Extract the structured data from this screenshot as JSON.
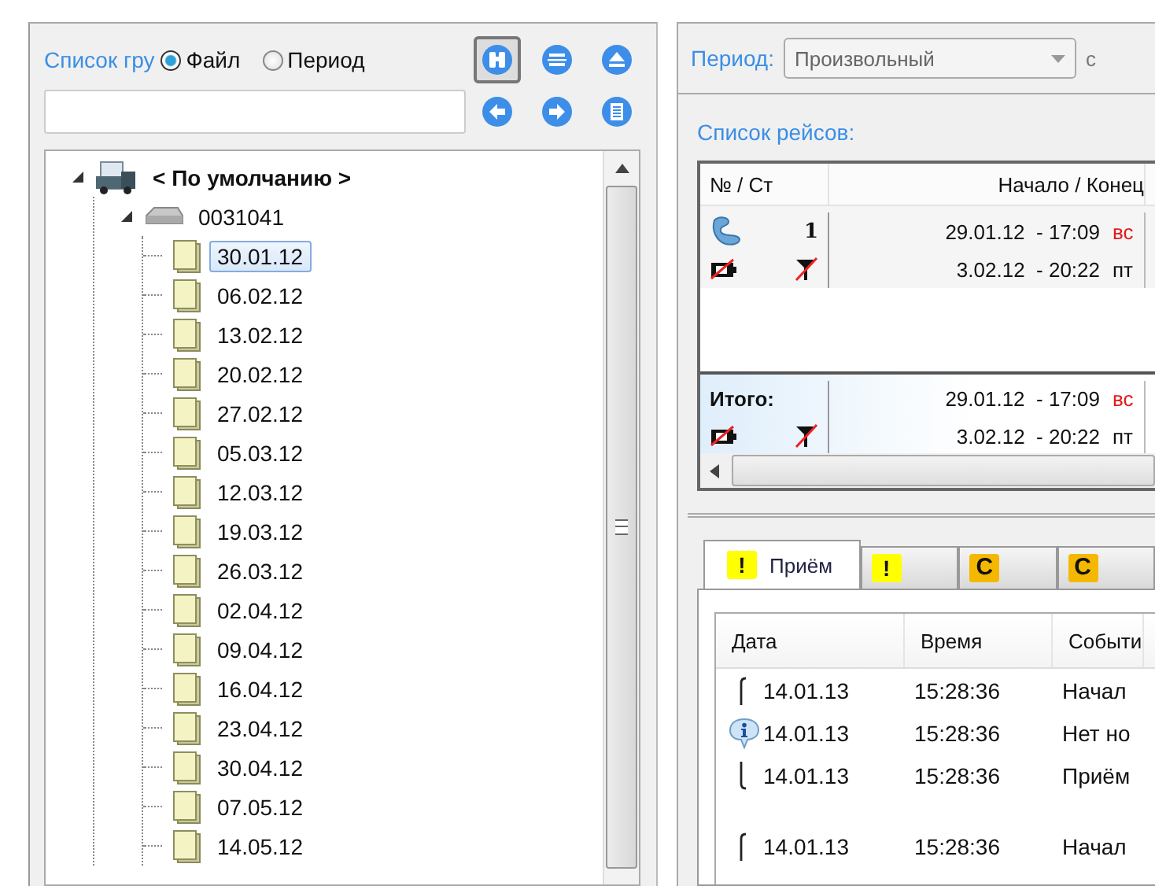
{
  "groups": {
    "title": "Список гру",
    "modes": [
      {
        "label": "Файл",
        "selected": true
      },
      {
        "label": "Период",
        "selected": false
      }
    ],
    "tool_buttons": [
      {
        "selected": true
      },
      {
        "selected": false
      },
      {
        "selected": false
      },
      {
        "selected": false
      },
      {
        "selected": false
      },
      {
        "selected": false
      }
    ]
  },
  "tree": [
    {
      "label": "< По умолчанию >",
      "kind": "root",
      "expanded": true,
      "selected": false,
      "children": [
        {
          "label": "0031041",
          "kind": "device",
          "expanded": true,
          "selected": false,
          "children": [
            {
              "label": "30.01.12",
              "kind": "file",
              "selected": true
            },
            {
              "label": "06.02.12",
              "kind": "file",
              "selected": false
            },
            {
              "label": "13.02.12",
              "kind": "file",
              "selected": false
            },
            {
              "label": "20.02.12",
              "kind": "file",
              "selected": false
            },
            {
              "label": "27.02.12",
              "kind": "file",
              "selected": false
            },
            {
              "label": "05.03.12",
              "kind": "file",
              "selected": false
            },
            {
              "label": "12.03.12",
              "kind": "file",
              "selected": false
            },
            {
              "label": "19.03.12",
              "kind": "file",
              "selected": false
            },
            {
              "label": "26.03.12",
              "kind": "file",
              "selected": false
            },
            {
              "label": "02.04.12",
              "kind": "file",
              "selected": false
            },
            {
              "label": "09.04.12",
              "kind": "file",
              "selected": false
            },
            {
              "label": "16.04.12",
              "kind": "file",
              "selected": false
            },
            {
              "label": "23.04.12",
              "kind": "file",
              "selected": false
            },
            {
              "label": "30.04.12",
              "kind": "file",
              "selected": false
            },
            {
              "label": "07.05.12",
              "kind": "file",
              "selected": false
            },
            {
              "label": "14.05.12",
              "kind": "file",
              "selected": false
            }
          ]
        }
      ]
    }
  ],
  "period": {
    "label": "Период:",
    "value": "Произвольный",
    "disabled": true,
    "trailing": "с"
  },
  "trips": {
    "title": "Список рейсов:",
    "columns": [
      "№ / Ст",
      "Начало / Конец"
    ],
    "rows": [
      {
        "kind": "trip",
        "number": "1",
        "start": "29.01.12  - 17:09",
        "start_day": "вс",
        "start_holiday": true,
        "end": "3.02.12  - 20:22",
        "end_day": "пт",
        "end_holiday": false
      },
      {
        "kind": "total",
        "number": "Итого:",
        "start": "29.01.12  - 17:09",
        "start_day": "вс",
        "start_holiday": true,
        "end": "3.02.12  - 20:22",
        "end_day": "пт",
        "end_holiday": false
      }
    ]
  },
  "tabs": [
    {
      "label": "Приём",
      "badge": "!",
      "kind": "alert",
      "selected": true
    },
    {
      "badge": "!",
      "kind": "alert",
      "selected": false
    },
    {
      "badge": "C",
      "kind": "counter",
      "selected": false
    },
    {
      "badge": "C",
      "kind": "counter",
      "selected": false
    }
  ],
  "events": {
    "columns": [
      "Дата",
      "Время",
      "Событи"
    ],
    "rows": [
      {
        "kind": "start",
        "date": "14.01.13",
        "time": "15:28:36",
        "event": "Начал"
      },
      {
        "kind": "info",
        "date": "14.01.13",
        "time": "15:28:36",
        "event": "Нет но"
      },
      {
        "kind": "end",
        "date": "14.01.13",
        "time": "15:28:36",
        "event": "Приём"
      },
      {
        "kind": "gap"
      },
      {
        "kind": "start",
        "date": "14.01.13",
        "time": "15:28:36",
        "event": "Начал"
      }
    ]
  }
}
